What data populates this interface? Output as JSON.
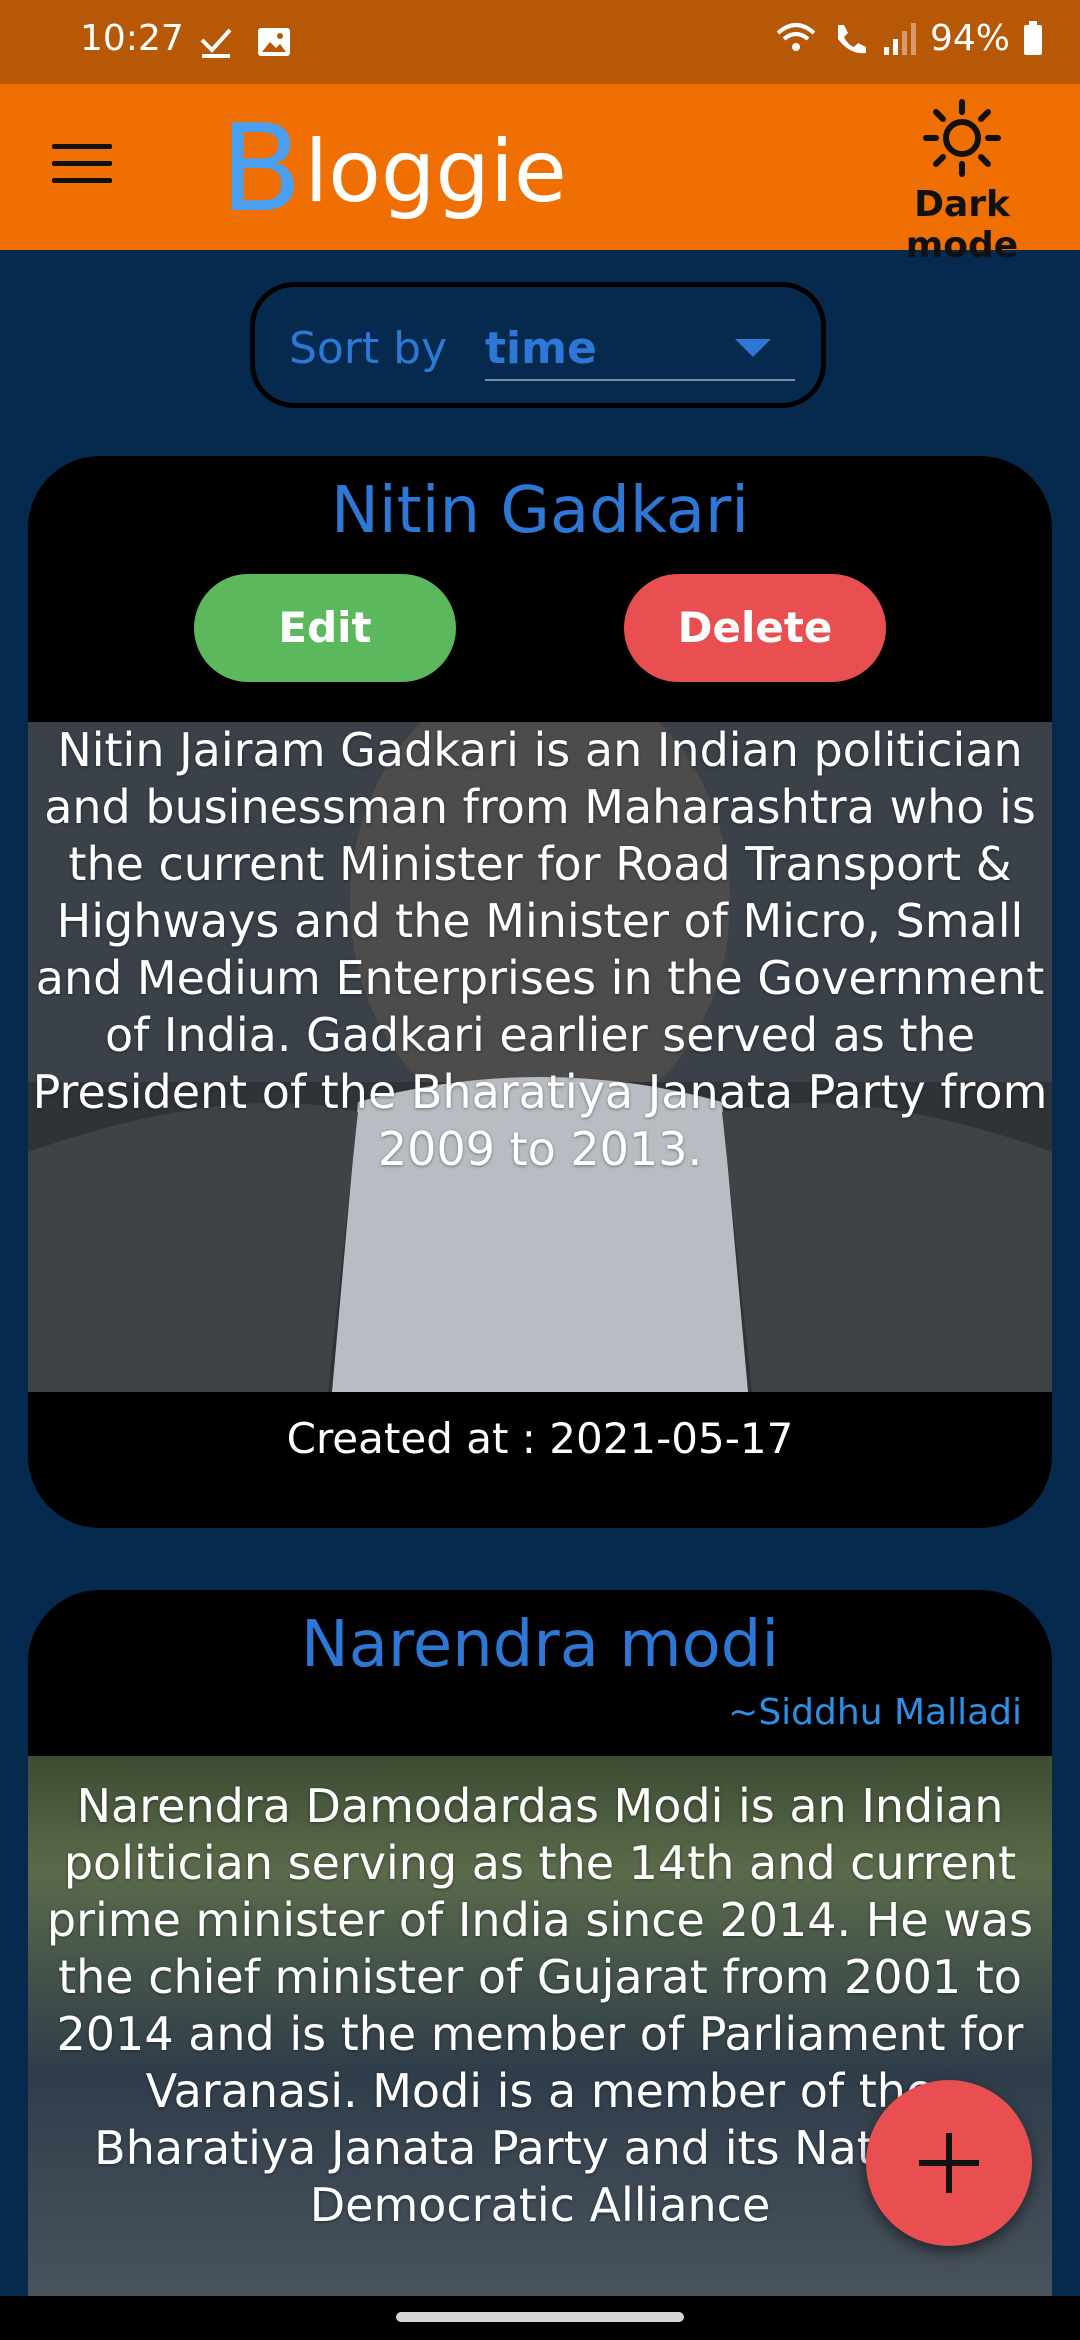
{
  "status_bar": {
    "time": "10:27",
    "battery": "94%",
    "icons": [
      "check-icon",
      "gallery-icon",
      "wifi-calling-icon",
      "signal-icon",
      "battery-icon"
    ]
  },
  "app_bar": {
    "brand_first": "B",
    "brand_rest": "loggie",
    "dark_mode_label": "Dark mode"
  },
  "sort": {
    "label": "Sort by",
    "value": "time"
  },
  "posts": [
    {
      "title": "Nitin Gadkari",
      "edit_label": "Edit",
      "delete_label": "Delete",
      "body": "Nitin Jairam Gadkari is an Indian politician and businessman from Maharashtra who is the current Minister for Road Transport & Highways and the Minister of Micro, Small and Medium Enterprises in the Government of India. Gadkari earlier served as the President of the Bharatiya Janata Party from 2009 to 2013.",
      "created": "Created at : 2021-05-17"
    },
    {
      "title": "Narendra modi",
      "author": "~Siddhu Malladi",
      "body": "Narendra Damodardas Modi is an Indian politician serving as the 14th and current prime minister of India since 2014. He was the chief minister of Gujarat from 2001 to 2014 and is the member of Parliament for Varanasi. Modi is a member of the Bharatiya Janata Party and its National Democratic Alliance"
    }
  ],
  "fab": {
    "icon": "plus-icon"
  },
  "colors": {
    "status_bar": "#b65805",
    "app_bar": "#ef6f02",
    "background": "#062a4d",
    "accent_blue": "#2d78d6",
    "edit_green": "#5cb85c",
    "delete_red": "#e94f50"
  }
}
